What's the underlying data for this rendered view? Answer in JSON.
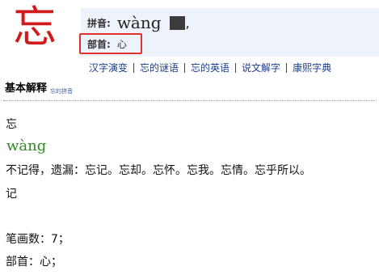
{
  "header": {
    "character": "忘"
  },
  "info": {
    "pinyin_label": "拼音:",
    "pinyin_value": "wàng",
    "pinyin_sep": ",",
    "radical_label": "部首:",
    "radical_value": "心"
  },
  "links": [
    "汉字演变",
    "忘的谜语",
    "忘的英语",
    "说文解字",
    "康熙字典"
  ],
  "section": {
    "title": "基本解释",
    "watermark": "忘的拼音"
  },
  "content": {
    "char": "忘",
    "pinyin": "wàng",
    "definition": "不记得，遗漏：忘记。忘却。忘怀。忘我。忘情。忘乎所以。",
    "continuation": "记",
    "stroke_count": "笔画数：7；",
    "radical": "部首：心；"
  },
  "colors": {
    "character": "#d11b1b",
    "highlight_border": "#e03030",
    "pinyin_green": "#2e8b1f",
    "link_blue": "#1a3f8f",
    "panel_bg": "#eef2fa"
  }
}
